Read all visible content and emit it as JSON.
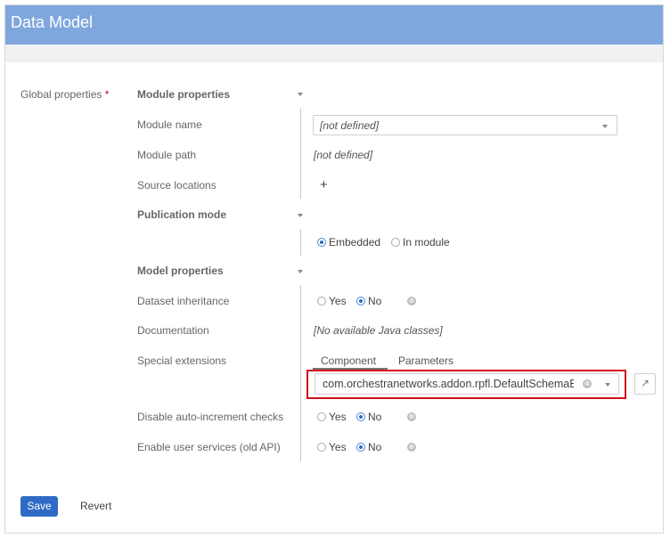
{
  "header": {
    "title": "Data Model"
  },
  "global_properties": {
    "label": "Global properties",
    "required_mark": "*"
  },
  "module_properties": {
    "section_label": "Module properties",
    "module_name": {
      "label": "Module name",
      "value": "[not defined]"
    },
    "module_path": {
      "label": "Module path",
      "value": "[not defined]"
    },
    "source_locations": {
      "label": "Source locations",
      "add_symbol": "+"
    }
  },
  "publication_mode": {
    "section_label": "Publication mode",
    "options": [
      "Embedded",
      "In module"
    ],
    "selected": "Embedded"
  },
  "model_properties": {
    "section_label": "Model properties",
    "dataset_inheritance": {
      "label": "Dataset inheritance",
      "yes": "Yes",
      "no": "No",
      "selected": "No"
    },
    "documentation": {
      "label": "Documentation",
      "value": "[No available Java classes]"
    },
    "special_extensions": {
      "label": "Special extensions",
      "tabs": [
        "Component",
        "Parameters"
      ],
      "active_tab": "Component",
      "value": "com.orchestranetworks.addon.rpfl.DefaultSchemaExte"
    },
    "disable_auto_increment": {
      "label": "Disable auto-increment checks",
      "yes": "Yes",
      "no": "No",
      "selected": "No"
    },
    "enable_user_services": {
      "label": "Enable user services (old API)",
      "yes": "Yes",
      "no": "No",
      "selected": "No"
    }
  },
  "footer": {
    "save_label": "Save",
    "revert_label": "Revert"
  },
  "icons": {
    "clear": "⊗",
    "external": "↗"
  },
  "colors": {
    "header": "#7fa7dd",
    "primary": "#2f6bc5",
    "highlight": "#d0101a"
  }
}
